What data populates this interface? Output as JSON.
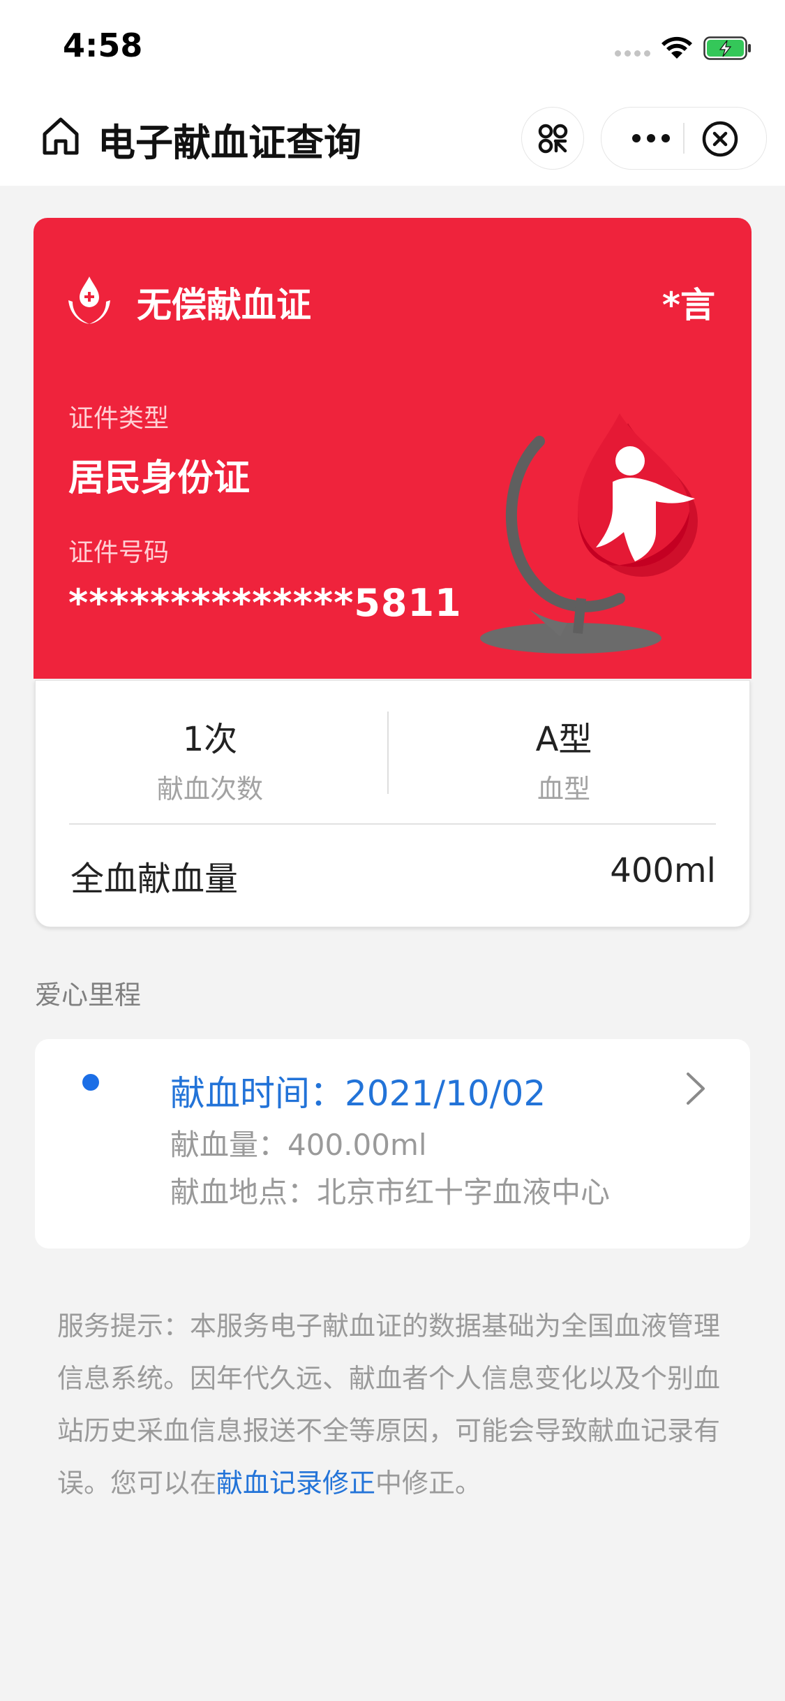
{
  "status_bar": {
    "time": "4:58"
  },
  "nav": {
    "title": "电子献血证查询",
    "home_icon": "home-icon",
    "scan_icon": "scan-icon",
    "more_icon": "more-icon",
    "close_icon": "close-circle-icon"
  },
  "card": {
    "title": "无偿献血证",
    "holder_name": "*言",
    "id_type_label": "证件类型",
    "id_type_value": "居民身份证",
    "id_number_label": "证件号码",
    "id_number_value": "**************5811",
    "accent_color": "#ef233c"
  },
  "stats": {
    "donation_count_value": "1次",
    "donation_count_label": "献血次数",
    "blood_type_value": "A型",
    "blood_type_label": "血型",
    "whole_blood_label": "全血献血量",
    "whole_blood_value": "400ml"
  },
  "section": {
    "title": "爱心里程"
  },
  "records": [
    {
      "time_label": "献血时间：2021/10/02",
      "volume_label": "献血量：400.00ml",
      "location_label": "献血地点：北京市红十字血液中心"
    }
  ],
  "notice": {
    "text_before": "服务提示：本服务电子献血证的数据基础为全国血液管理信息系统。因年代久远、献血者个人信息变化以及个别血站历史采血信息报送不全等原因，可能会导致献血记录有误。您可以在",
    "link": "献血记录修正",
    "text_after": "中修正。"
  }
}
